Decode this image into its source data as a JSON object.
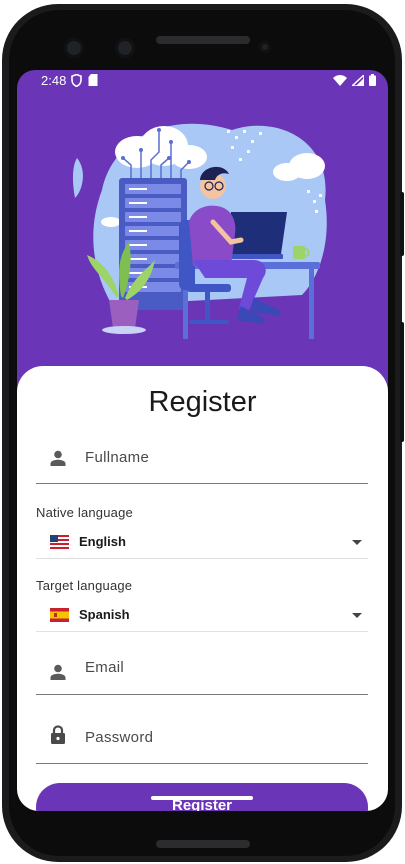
{
  "status_bar": {
    "time": "2:48"
  },
  "form": {
    "title": "Register",
    "fullname_placeholder": "Fullname",
    "native_language_label": "Native language",
    "native_language_value": "English",
    "target_language_label": "Target language",
    "target_language_value": "Spanish",
    "email_placeholder": "Email",
    "password_placeholder": "Password",
    "register_button": "Register"
  },
  "colors": {
    "primary": "#6a35b6"
  },
  "icons": [
    "person-icon",
    "lock-icon",
    "us-flag-icon",
    "spain-flag-icon",
    "dropdown-caret-icon"
  ]
}
